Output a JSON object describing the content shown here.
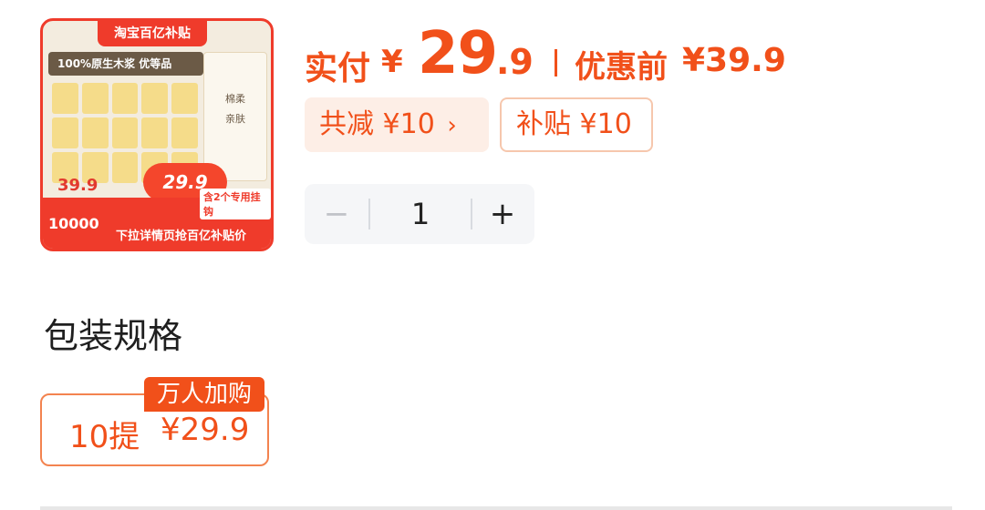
{
  "product": {
    "image": {
      "banner": "淘宝百亿补贴",
      "tagline": "100%原生木浆 优等品",
      "pack_text_1": "棉柔",
      "pack_text_2": "亲肤",
      "orig_price": "39.9",
      "price_burst": "29.9",
      "count_text": "10000",
      "bottom_text": "下拉详情页抢百亿补贴价",
      "hook_text": "含2个专用挂钩"
    }
  },
  "price": {
    "paid_label": "实付",
    "currency": "¥",
    "paid_integer": "29",
    "paid_decimal": ".9",
    "original_label": "优惠前",
    "original_price": "¥39.9"
  },
  "discounts": {
    "reduce_label": "共减 ¥10",
    "reduce_chevron": "›",
    "subsidy_label": "补贴 ¥10"
  },
  "quantity": {
    "minus": "−",
    "value": "1",
    "plus": "+"
  },
  "spec_section": {
    "title": "包装规格",
    "options": [
      {
        "label": "10提",
        "price": "¥29.9",
        "badge": "万人加购",
        "selected": true
      }
    ]
  },
  "colors": {
    "accent": "#f1501a",
    "chip_bg": "#fdeee6",
    "stepper_bg": "#f5f6f8"
  }
}
